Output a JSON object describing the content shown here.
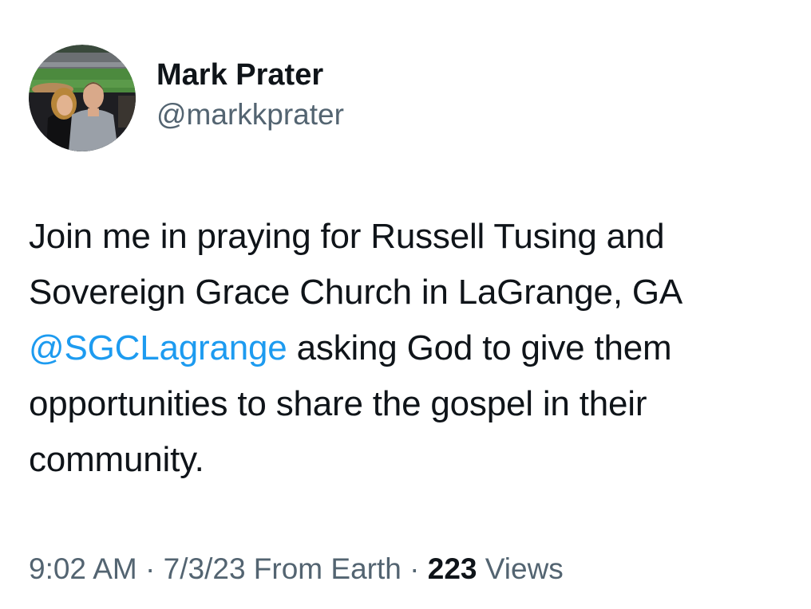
{
  "author": {
    "display_name": "Mark Prater",
    "handle": "@markkprater"
  },
  "tweet": {
    "text_parts": {
      "p1": "Join me in praying for Russell Tusing and Sovereign Grace Church in LaGrange, GA ",
      "mention": "@SGCLagrange",
      "p2": " asking God to give them opportunities to share the gospel in their community."
    },
    "time": "9:02 AM",
    "sep1": " · ",
    "date": "7/3/23",
    "source": " From Earth",
    "sep2": " · ",
    "view_count": "223",
    "views_label": " Views"
  },
  "colors": {
    "mention": "#1d9bf0",
    "secondary_text": "#536471",
    "primary_text": "#0f1419"
  },
  "icons": {
    "avatar": "profile-photo"
  }
}
